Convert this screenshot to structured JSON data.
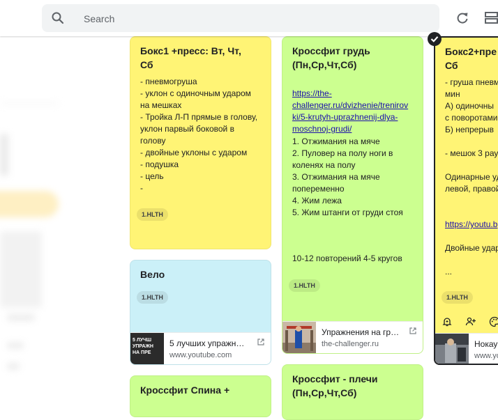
{
  "search": {
    "placeholder": "Search"
  },
  "icons": {
    "search": "search-icon",
    "refresh": "refresh-icon",
    "view": "list-view-icon",
    "check": "check-icon",
    "reminder": "bell-plus-icon",
    "collaborator": "person-add-icon",
    "palette": "palette-icon",
    "external": "open-external-icon"
  },
  "colors": {
    "yellow_note": "#fff475",
    "green_note": "#ccff90",
    "blue_note": "#cbf0f8",
    "link": "#1a0dab"
  },
  "notes": {
    "box1": {
      "title": "Бокс1 +пресс: Вт, Чт,\nСб",
      "body": "- пневмогруша\n- уклон с одиночным ударом\nна мешках\n- Тройка Л-П прямые в голову,\nуклон парвый боковой в\nголову\n- двойные уклоны с ударом\n- подушка\n- цель\n-",
      "label": "1.HLTH"
    },
    "velo": {
      "title": "Вело",
      "label": "1.HLTH",
      "preview_title": "5 лучших упражн…",
      "preview_domain": "www.youtube.com",
      "thumb_text": "5 ЛУЧШ\nУПРАЖН\nНА ПРЕ"
    },
    "back": {
      "title": "Кроссфит Спина +"
    },
    "chest": {
      "title": "Кроссфит грудь\n(Пн,Ср,Чт,Сб)",
      "link": "https://the-\nchallenger.ru/dvizhenie/trenirov\nki/5-krutyh-uprazhnenij-dlya-\nmoschnoj-grudi/",
      "body": "1. Отжимания на мяче\n2. Пуловер на полу ноги в\nколенях на полу\n3. Отжимания на мяче\nпопеременно\n4. Жим лежа\n5. Жим штанги от груди стоя",
      "reps": "10-12 повторений 4-5 кругов",
      "label": "1.HLTH",
      "preview_title": "Упражнения на гр…",
      "preview_domain": "the-challenger.ru"
    },
    "shoulders": {
      "title": "Кроссфит - плечи\n(Пн,Ср,Чт,Сб)"
    },
    "box2": {
      "title": "Бокс2+пре\nСб",
      "body": "- груша пневм\nмин\n А) одиночны\nс поворотами\n Б) непрерыв\n\n- мешок 3 рау\n\nОдинарные уд\nлевой, правой",
      "link": "https://youtu.b",
      "body2": "Двойные удар\n\n...",
      "label": "1.HLTH",
      "preview_title": "Нокау",
      "preview_domain": "www.you"
    }
  }
}
